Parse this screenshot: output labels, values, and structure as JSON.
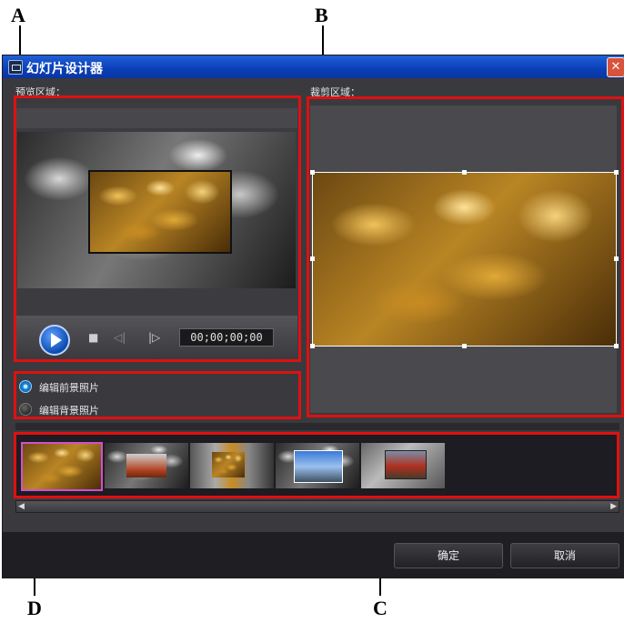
{
  "callouts": {
    "a": "A",
    "b": "B",
    "c": "C",
    "d": "D"
  },
  "window": {
    "title": "幻灯片设计器",
    "close": "✕",
    "preview_label": "预览区域：",
    "crop_label": "裁剪区域："
  },
  "player": {
    "timecode": "00;00;00;00",
    "stop": "■",
    "prev": "◁|",
    "next": "|▷"
  },
  "options": {
    "edit_foreground": "编辑前景照片",
    "edit_background": "编辑背景照片",
    "selected": "edit_foreground"
  },
  "thumbnails": [
    {
      "name": "slide-1",
      "selected": true
    },
    {
      "name": "slide-2",
      "selected": false
    },
    {
      "name": "slide-3",
      "selected": false
    },
    {
      "name": "slide-4",
      "selected": false
    },
    {
      "name": "slide-5",
      "selected": false
    }
  ],
  "scroll": {
    "left": "◀",
    "right": "▶"
  },
  "buttons": {
    "ok": "确定",
    "cancel": "取消"
  },
  "colors": {
    "annotation_red": "#e01010",
    "titlebar_blue": "#0b3fb8",
    "selected_thumb": "#d04fd0"
  }
}
